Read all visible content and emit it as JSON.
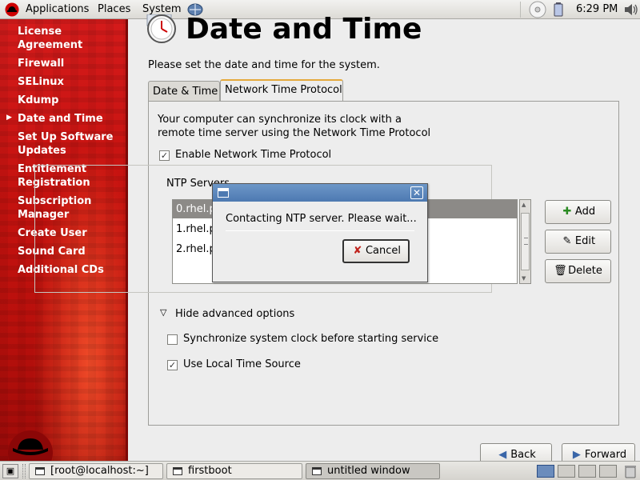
{
  "top_panel": {
    "menus": [
      "Applications",
      "Places",
      "System"
    ],
    "clock": "6:29 PM"
  },
  "sidebar": {
    "items": [
      {
        "label": "License Agreement",
        "current": false
      },
      {
        "label": "Firewall",
        "current": false
      },
      {
        "label": "SELinux",
        "current": false
      },
      {
        "label": "Kdump",
        "current": false
      },
      {
        "label": "Date and Time",
        "current": true
      },
      {
        "label": "Set Up Software Updates",
        "current": false
      },
      {
        "label": "Entitlement Registration",
        "current": false
      },
      {
        "label": "Subscription Manager",
        "current": false
      },
      {
        "label": "Create User",
        "current": false
      },
      {
        "label": "Sound Card",
        "current": false
      },
      {
        "label": "Additional CDs",
        "current": false
      }
    ]
  },
  "main": {
    "title": "Date and Time",
    "subtitle": "Please set the date and time for the system.",
    "tabs": [
      "Date & Time",
      "Network Time Protocol"
    ],
    "ntp": {
      "description": "Your computer can synchronize its clock with a remote time server using the Network Time Protocol",
      "enable_label": "Enable Network Time Protocol",
      "enable_checked": true,
      "servers_label": "NTP Servers",
      "servers": [
        "0.rhel.p",
        "1.rhel.p",
        "2.rhel.p"
      ],
      "add_label": "Add",
      "edit_label": "Edit",
      "delete_label": "Delete",
      "advanced_toggle": "Hide advanced options",
      "sync_label": "Synchronize system clock before starting service",
      "sync_checked": false,
      "local_source_label": "Use Local Time Source",
      "local_source_checked": true
    },
    "back_label": "Back",
    "forward_label": "Forward"
  },
  "dialog": {
    "message": "Contacting NTP server.  Please wait...",
    "cancel_label": "Cancel"
  },
  "taskbar": {
    "tasks": [
      {
        "label": "[root@localhost:~]",
        "active": false
      },
      {
        "label": "firstboot",
        "active": false
      },
      {
        "label": "untitled window",
        "active": true
      }
    ]
  },
  "colors": {
    "sidebar_red": "#c5120f",
    "selection": "#8c8a87",
    "titlebar_blue": "#5a86bd",
    "tab_highlight": "#e5a93c"
  }
}
